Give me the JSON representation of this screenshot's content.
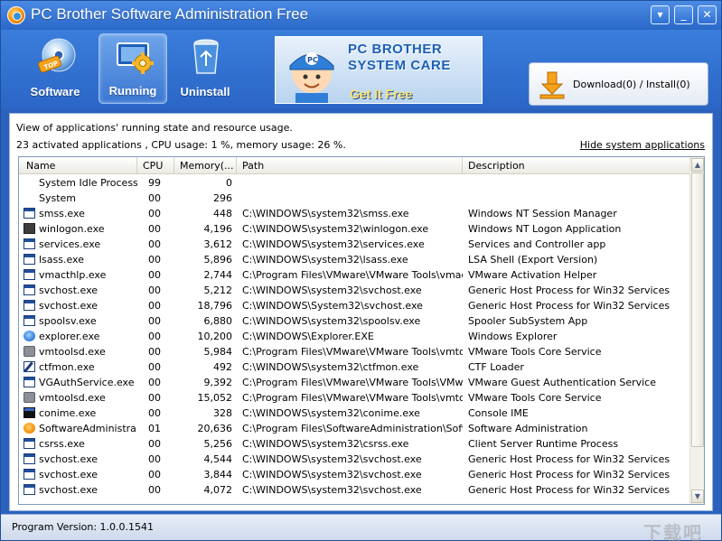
{
  "window": {
    "title": "PC Brother Software Administration Free",
    "controls": [
      "▾",
      "_",
      "✕"
    ]
  },
  "toolbar": {
    "nav": [
      {
        "label": "Software",
        "icon": "software-disc-icon"
      },
      {
        "label": "Running",
        "icon": "running-gear-icon",
        "active": true
      },
      {
        "label": "Uninstall",
        "icon": "recycle-bin-icon"
      }
    ],
    "banner": {
      "brand_line1": "PC BROTHER",
      "brand_line2": "SYSTEM CARE",
      "cta": "Get It Free"
    },
    "download_label": "Download(0) / Install(0)"
  },
  "content": {
    "description": "View of applications' running state and resource usage.",
    "summary": "23 activated applications , CPU usage: 1 %, memory usage: 26 %.",
    "hide_link": "Hide system applications",
    "columns": [
      "Name",
      "CPU",
      "Memory(...",
      "Path",
      "Description"
    ],
    "rows": [
      {
        "icon": "none",
        "name": "System Idle Process",
        "cpu": "99",
        "mem": "0",
        "path": "",
        "desc": ""
      },
      {
        "icon": "none",
        "name": "System",
        "cpu": "00",
        "mem": "296",
        "path": "",
        "desc": ""
      },
      {
        "icon": "window",
        "name": "smss.exe",
        "cpu": "00",
        "mem": "448",
        "path": "C:\\WINDOWS\\system32\\smss.exe",
        "desc": "Windows NT Session Manager"
      },
      {
        "icon": "lock",
        "name": "winlogon.exe",
        "cpu": "00",
        "mem": "4,196",
        "path": "C:\\WINDOWS\\system32\\winlogon.exe",
        "desc": "Windows NT Logon Application"
      },
      {
        "icon": "window",
        "name": "services.exe",
        "cpu": "00",
        "mem": "3,612",
        "path": "C:\\WINDOWS\\system32\\services.exe",
        "desc": "Services and Controller app"
      },
      {
        "icon": "window",
        "name": "lsass.exe",
        "cpu": "00",
        "mem": "5,896",
        "path": "C:\\WINDOWS\\system32\\lsass.exe",
        "desc": "LSA Shell (Export Version)"
      },
      {
        "icon": "window",
        "name": "vmacthlp.exe",
        "cpu": "00",
        "mem": "2,744",
        "path": "C:\\Program Files\\VMware\\VMware Tools\\vmact...",
        "desc": "VMware Activation Helper"
      },
      {
        "icon": "window",
        "name": "svchost.exe",
        "cpu": "00",
        "mem": "5,212",
        "path": "C:\\WINDOWS\\system32\\svchost.exe",
        "desc": "Generic Host Process for Win32 Services"
      },
      {
        "icon": "window",
        "name": "svchost.exe",
        "cpu": "00",
        "mem": "18,796",
        "path": "C:\\WINDOWS\\System32\\svchost.exe",
        "desc": "Generic Host Process for Win32 Services"
      },
      {
        "icon": "window",
        "name": "spoolsv.exe",
        "cpu": "00",
        "mem": "6,880",
        "path": "C:\\WINDOWS\\system32\\spoolsv.exe",
        "desc": "Spooler SubSystem App"
      },
      {
        "icon": "explorer",
        "name": "explorer.exe",
        "cpu": "00",
        "mem": "10,200",
        "path": "C:\\WINDOWS\\Explorer.EXE",
        "desc": "Windows Explorer"
      },
      {
        "icon": "vm",
        "name": "vmtoolsd.exe",
        "cpu": "00",
        "mem": "5,984",
        "path": "C:\\Program Files\\VMware\\VMware Tools\\vmtoo...",
        "desc": "VMware Tools Core Service"
      },
      {
        "icon": "pen",
        "name": "ctfmon.exe",
        "cpu": "00",
        "mem": "492",
        "path": "C:\\WINDOWS\\system32\\ctfmon.exe",
        "desc": "CTF Loader"
      },
      {
        "icon": "window",
        "name": "VGAuthService.exe",
        "cpu": "00",
        "mem": "9,392",
        "path": "C:\\Program Files\\VMware\\VMware Tools\\VMwa...",
        "desc": "VMware Guest Authentication Service"
      },
      {
        "icon": "vm",
        "name": "vmtoolsd.exe",
        "cpu": "00",
        "mem": "15,052",
        "path": "C:\\Program Files\\VMware\\VMware Tools\\vmtoo...",
        "desc": "VMware Tools Core Service"
      },
      {
        "icon": "console",
        "name": "conime.exe",
        "cpu": "00",
        "mem": "328",
        "path": "C:\\WINDOWS\\system32\\conime.exe",
        "desc": "Console IME"
      },
      {
        "icon": "app",
        "name": "SoftwareAdministra...",
        "cpu": "01",
        "mem": "20,636",
        "path": "C:\\Program Files\\SoftwareAdministration\\Soft...",
        "desc": "Software Administration"
      },
      {
        "icon": "window",
        "name": "csrss.exe",
        "cpu": "00",
        "mem": "5,256",
        "path": "C:\\WINDOWS\\system32\\csrss.exe",
        "desc": "Client Server Runtime Process"
      },
      {
        "icon": "window",
        "name": "svchost.exe",
        "cpu": "00",
        "mem": "4,544",
        "path": "C:\\WINDOWS\\system32\\svchost.exe",
        "desc": "Generic Host Process for Win32 Services"
      },
      {
        "icon": "window",
        "name": "svchost.exe",
        "cpu": "00",
        "mem": "3,844",
        "path": "C:\\WINDOWS\\system32\\svchost.exe",
        "desc": "Generic Host Process for Win32 Services"
      },
      {
        "icon": "window",
        "name": "svchost.exe",
        "cpu": "00",
        "mem": "4,072",
        "path": "C:\\WINDOWS\\system32\\svchost.exe",
        "desc": "Generic Host Process for Win32 Services"
      }
    ]
  },
  "status": {
    "version": "Program Version: 1.0.0.1541",
    "watermark": "下载吧"
  },
  "colors": {
    "title_bar": "#2a68c8",
    "toolbar": "#2b66c6",
    "status_bar": "#cdd9ec"
  }
}
